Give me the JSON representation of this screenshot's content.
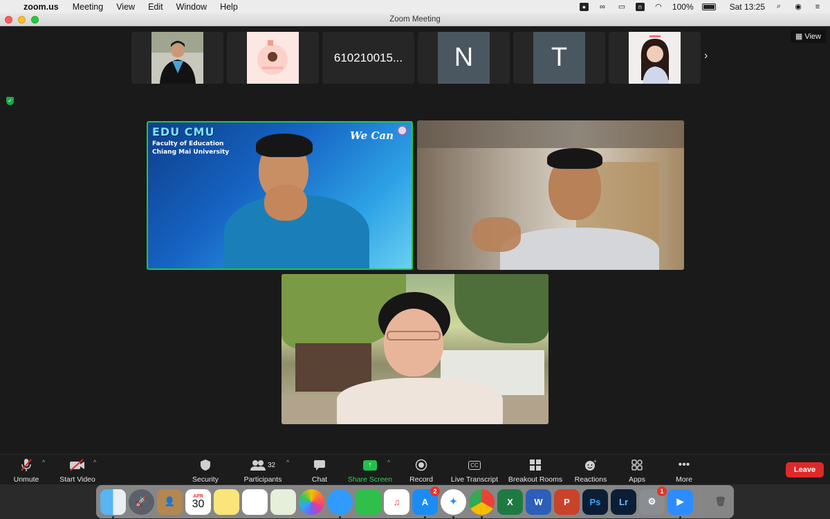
{
  "menubar": {
    "app_name": "zoom.us",
    "menus": [
      "Meeting",
      "View",
      "Edit",
      "Window",
      "Help"
    ],
    "battery": "100%",
    "clock": "Sat 13:25"
  },
  "window": {
    "title": "Zoom Meeting"
  },
  "top_right": {
    "view_label": "View"
  },
  "thumbnails": [
    {
      "kind": "photo",
      "icon": "graduate-photo"
    },
    {
      "kind": "photo",
      "icon": "illustration-photo"
    },
    {
      "kind": "text",
      "name": "610210015..."
    },
    {
      "kind": "letter",
      "letter": "N"
    },
    {
      "kind": "letter",
      "letter": "T"
    },
    {
      "kind": "photo",
      "icon": "woman-photo"
    }
  ],
  "tile1": {
    "title": "EDU CMU",
    "line1": "Faculty of Education",
    "line2": "Chiang Mai University",
    "slogan": "We Can"
  },
  "toolbar": {
    "unmute": "Unmute",
    "start_video": "Start Video",
    "security": "Security",
    "participants": "Participants",
    "participants_count": "32",
    "chat": "Chat",
    "share_screen": "Share Screen",
    "record": "Record",
    "live_transcript": "Live Transcript",
    "live_transcript_icon": "CC",
    "breakout_rooms": "Breakout Rooms",
    "reactions": "Reactions",
    "apps": "Apps",
    "more": "More",
    "leave": "Leave"
  },
  "dock": {
    "calendar_month": "APR",
    "calendar_day": "30",
    "appstore_badge": "2",
    "settings_badge": "1",
    "word_label": "W",
    "excel_label": "X",
    "ppt_label": "P",
    "ps_label": "Ps",
    "lr_label": "Lr"
  },
  "colors": {
    "active_speaker_border": "#25c740",
    "leave_button": "#e02828",
    "share_green": "#22c04a"
  }
}
